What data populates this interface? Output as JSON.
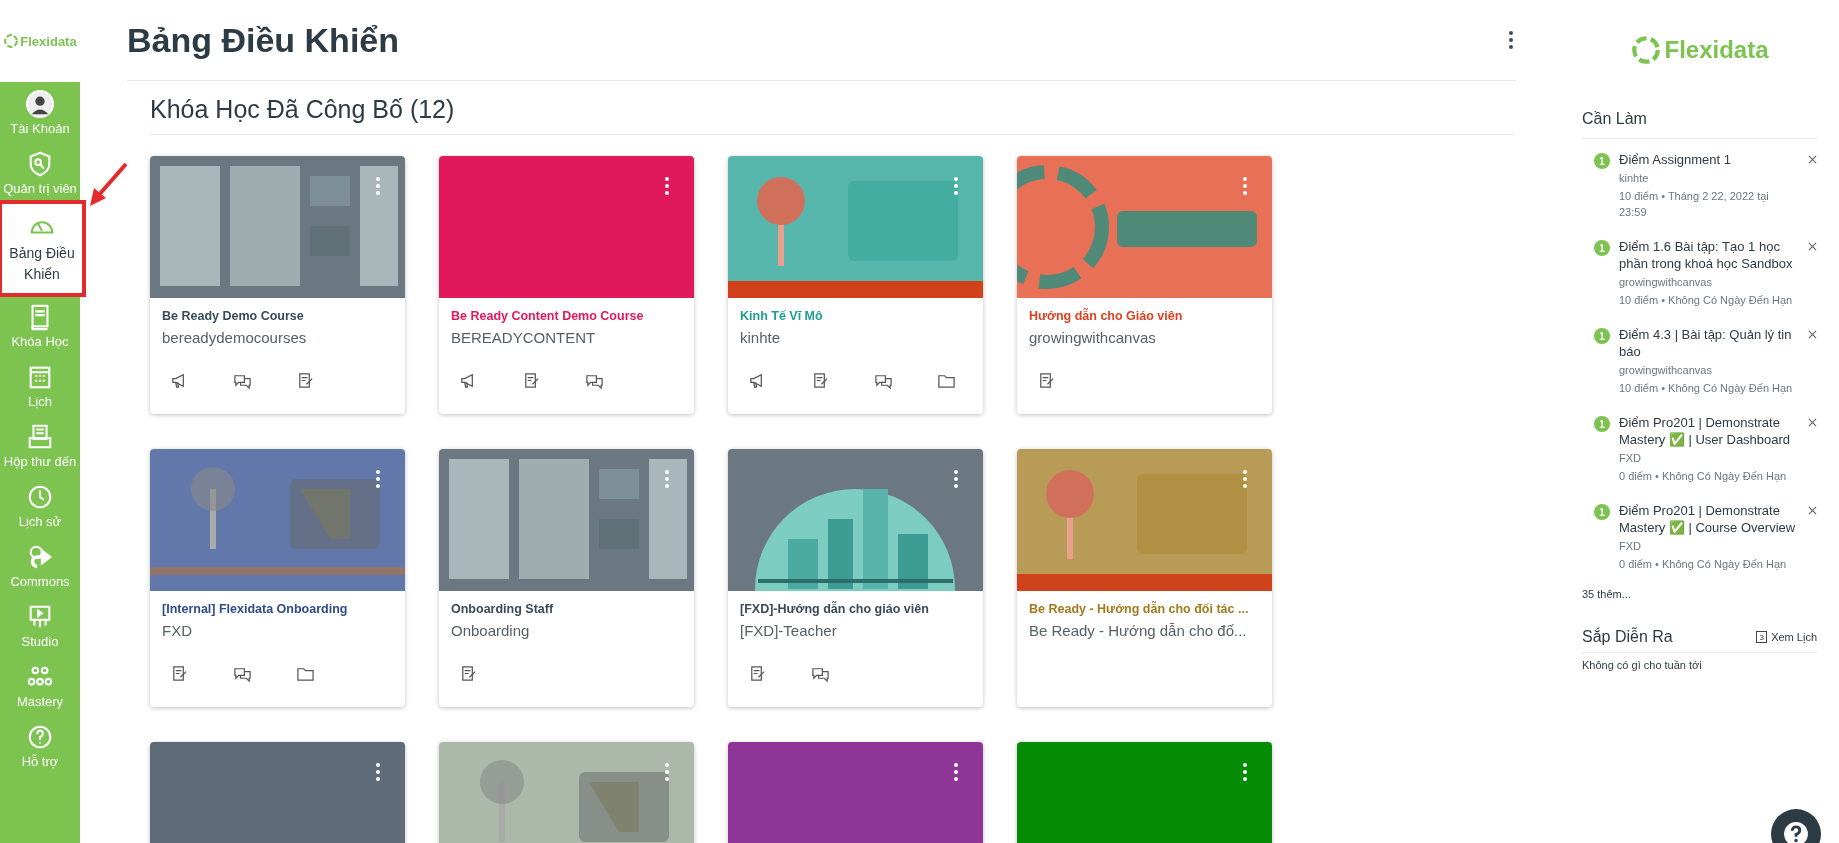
{
  "brand": {
    "logo_text": "Flexidata"
  },
  "nav": [
    {
      "label": "Tài Khoản",
      "kind": "avatar",
      "selected": false
    },
    {
      "label": "Quản trị viên",
      "kind": "shield",
      "selected": false
    },
    {
      "label": "Bảng Điều Khiển",
      "kind": "gauge",
      "selected": true,
      "highlighted": true
    },
    {
      "label": "Khóa Học",
      "kind": "book",
      "selected": false
    },
    {
      "label": "Lịch",
      "kind": "calendar",
      "selected": false
    },
    {
      "label": "Hộp thư đến",
      "kind": "inbox",
      "selected": false
    },
    {
      "label": "Lịch sử",
      "kind": "clock",
      "selected": false
    },
    {
      "label": "Commons",
      "kind": "share",
      "selected": false
    },
    {
      "label": "Studio",
      "kind": "studio",
      "selected": false
    },
    {
      "label": "Mastery",
      "kind": "mastery",
      "selected": false
    },
    {
      "label": "Hỗ trợ",
      "kind": "help",
      "selected": false
    }
  ],
  "page": {
    "title": "Bảng Điều Khiển",
    "section_title": "Khóa Học Đã Công Bố (12)"
  },
  "courses": [
    {
      "title": "Be Ready Demo Course",
      "subtitle": "bereadydemocourses",
      "color": "#394b58",
      "kind": "picture",
      "icons": [
        {
          "kind": "announcement"
        },
        {
          "kind": "discussion"
        },
        {
          "kind": "assignment"
        }
      ]
    },
    {
      "title": "Be Ready Content Demo Course",
      "subtitle": "BEREADYCONTENT",
      "color": "#e0195c",
      "kind": "plain",
      "icons": [
        {
          "kind": "announcement"
        },
        {
          "kind": "assignment"
        },
        {
          "kind": "discussion"
        }
      ]
    },
    {
      "title": "Kinh Tế Vĩ Mô",
      "subtitle": "kinhte",
      "color": "#1f9e8f",
      "kind": "picture",
      "icons": [
        {
          "kind": "announcement"
        },
        {
          "kind": "assignment"
        },
        {
          "kind": "discussion"
        },
        {
          "kind": "folder"
        }
      ]
    },
    {
      "title": "Hướng dẫn cho Giáo viên",
      "subtitle": "growingwithcanvas",
      "color": "#e0401f",
      "kind": "picture",
      "icons": [
        {
          "kind": "assignment"
        }
      ]
    },
    {
      "title": "[Internal] Flexidata Onboarding",
      "subtitle": "FXD",
      "color": "#2e4b8f",
      "kind": "picture",
      "icons": [
        {
          "kind": "assignment"
        },
        {
          "kind": "discussion"
        },
        {
          "kind": "folder"
        }
      ]
    },
    {
      "title": "Onboarding Staff",
      "subtitle": "Onboarding",
      "color": "#394b58",
      "kind": "picture",
      "icons": [
        {
          "kind": "assignment"
        }
      ]
    },
    {
      "title": "[FXD]-Hướng dẫn cho giáo viên",
      "subtitle": "[FXD]-Teacher",
      "color": "#394b58",
      "kind": "picture",
      "icons": [
        {
          "kind": "assignment"
        },
        {
          "kind": "discussion"
        }
      ]
    },
    {
      "title": "Be Ready - Hướng dẫn cho đối tác ...",
      "subtitle": "Be Ready - Hướng dẫn cho đố...",
      "color": "#a07a1d",
      "kind": "picture"
    },
    {
      "color": "#5e6b78",
      "kind": "plain"
    },
    {
      "color": "#8fa08e",
      "kind": "picture"
    },
    {
      "color": "#8e3598",
      "kind": "plain"
    },
    {
      "color": "#048c04",
      "kind": "plain"
    }
  ],
  "right_logo": {
    "logo_text": "Flexidata"
  },
  "todo": {
    "title": "Cần Làm",
    "items": [
      {
        "badge": "1",
        "title": "Điểm Assignment 1",
        "course": "kinhte",
        "meta": "10 điểm • Tháng 2 22, 2022 tại 23:59"
      },
      {
        "badge": "1",
        "title": "Điểm 1.6 Bài tập: Tạo 1 học phần trong khoá học Sandbox",
        "course": "growingwithcanvas",
        "meta": "10 điểm • Không Có Ngày Đến Hạn"
      },
      {
        "badge": "1",
        "title": "Điểm 4.3 | Bài tập: Quản lý tin báo",
        "course": "growingwithcanvas",
        "meta": "10 điểm • Không Có Ngày Đến Hạn"
      },
      {
        "badge": "1",
        "title": "Điểm Pro201 | Demonstrate Mastery ✅ | User Dashboard",
        "course": "FXD",
        "meta": "0 điểm • Không Có Ngày Đến Hạn"
      },
      {
        "badge": "1",
        "title": "Điểm Pro201 | Demonstrate Mastery ✅ | Course Overview",
        "course": "FXD",
        "meta": "0 điểm • Không Có Ngày Đến Hạn"
      }
    ],
    "more": "35 thêm..."
  },
  "upcoming": {
    "title": "Sắp Diễn Ra",
    "calendar_day": "3",
    "link": "Xem Lịch",
    "empty": "Không có gì cho tuần tới"
  }
}
